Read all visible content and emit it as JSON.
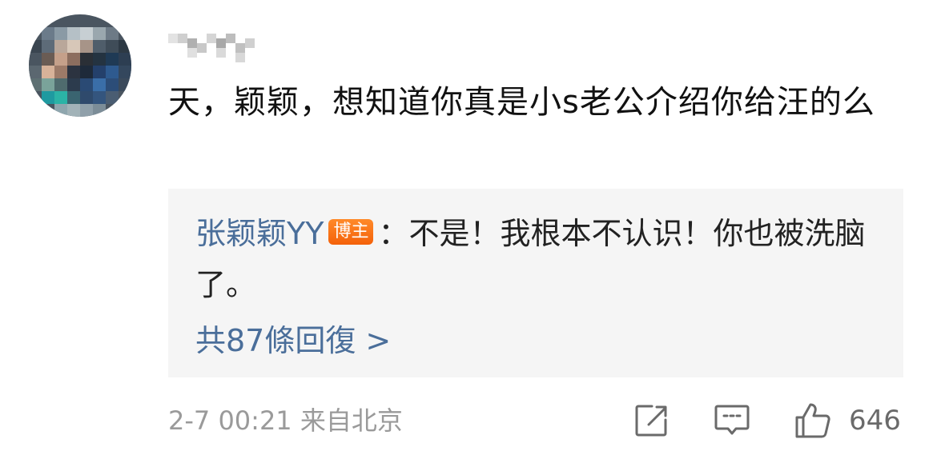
{
  "comment": {
    "text": "天，颖颖，想知道你真是小s老公介绍你给汪的么"
  },
  "reply": {
    "author": "张颖颖YY",
    "badge": "博主",
    "text": "：不是！我根本不认识！你也被洗脑了。",
    "more_replies": "共87條回復 >"
  },
  "meta": {
    "timestamp": "2-7 00:21",
    "location": "来自北京"
  },
  "actions": {
    "like_count": "646",
    "share_icon": "share-icon",
    "comment_icon": "comment-icon",
    "like_icon": "thumbs-up-icon"
  },
  "colors": {
    "link_blue": "#4a6e9a",
    "badge_orange": "#f4610a",
    "reply_bg": "#f5f5f5",
    "meta_gray": "#9a9a9a"
  }
}
